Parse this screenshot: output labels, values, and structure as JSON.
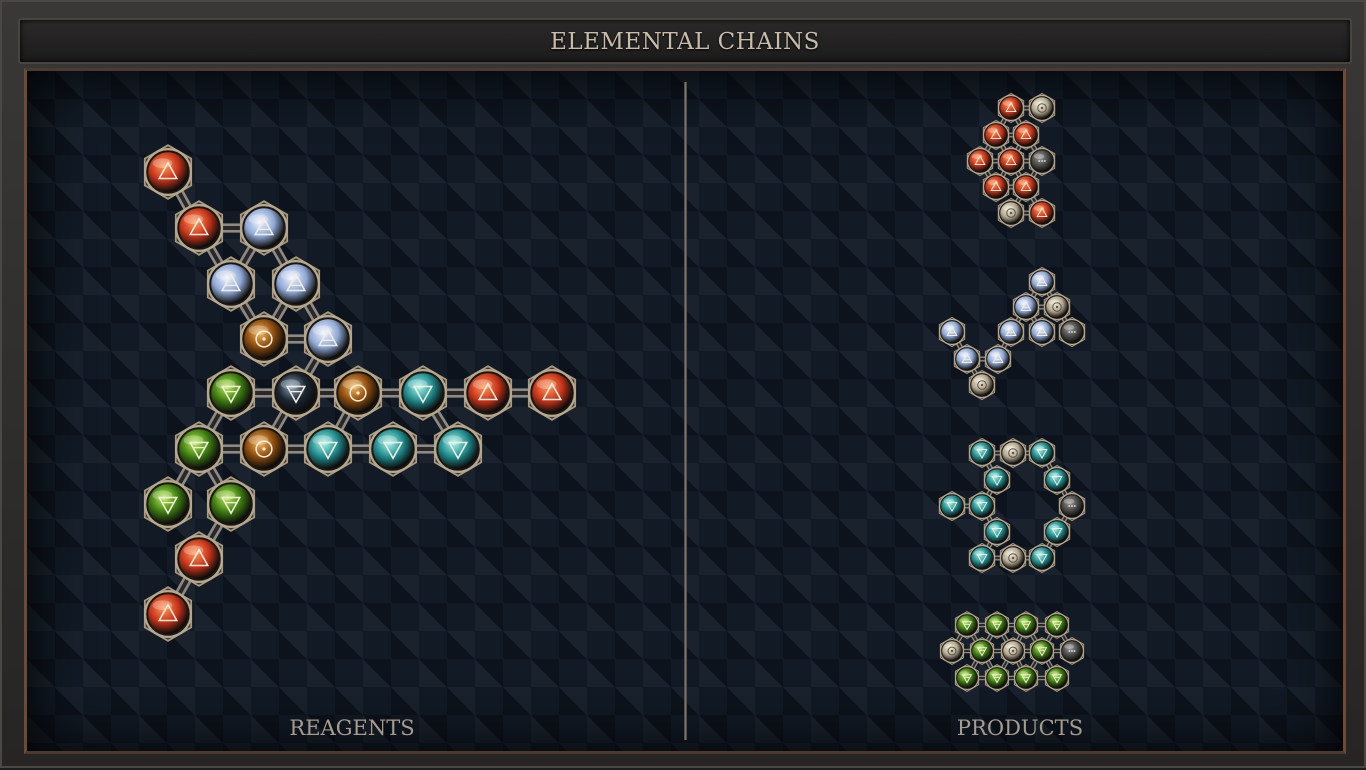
{
  "window": {
    "title": "ELEMENTAL CHAINS"
  },
  "panels": {
    "reagents_label": "REAGENTS",
    "products_label": "PRODUCTS"
  },
  "atom_types": {
    "fire": {
      "color": "#c8341a",
      "highlight": "#ff9a5a",
      "glyph": "triangle-up-icon"
    },
    "air": {
      "color": "#8fa9d6",
      "highlight": "#f2f6ff",
      "glyph": "triangle-up-bar-icon"
    },
    "water": {
      "color": "#1f8a8c",
      "highlight": "#a8f5ea",
      "glyph": "triangle-down-icon"
    },
    "earth": {
      "color": "#3d7a12",
      "highlight": "#b9ef55",
      "glyph": "triangle-down-bar-icon"
    },
    "salt": {
      "color": "#8a4a0c",
      "highlight": "#f5b55a",
      "glyph": "circle-dot-icon"
    },
    "quintessence": {
      "color": "#1b2530",
      "highlight": "#8aa4bd",
      "glyph": "triangle-down-bar-icon"
    },
    "vitae": {
      "color": "#b6ab93",
      "highlight": "#f1ead5",
      "glyph": "circle-dot-icon"
    },
    "mors": {
      "color": "#4a4a48",
      "highlight": "#9a9a96",
      "glyph": "dots-icon"
    }
  },
  "reagent": {
    "atoms": [
      "fire",
      "fire",
      "air",
      "air",
      "air",
      "salt",
      "air",
      "earth",
      "quintessence",
      "salt",
      "water",
      "fire",
      "fire",
      "earth",
      "salt",
      "water",
      "water",
      "water",
      "earth",
      "earth",
      "fire",
      "fire"
    ]
  },
  "products": [
    {
      "name": "product-1",
      "atoms": [
        "fire",
        "vitae",
        "fire",
        "fire",
        "fire",
        "fire",
        "mors",
        "fire",
        "fire",
        "vitae",
        "fire"
      ]
    },
    {
      "name": "product-2",
      "atoms": [
        "air",
        "air",
        "vitae",
        "air",
        "air",
        "mors",
        "air",
        "air",
        "vitae",
        "air"
      ]
    },
    {
      "name": "product-3",
      "atoms": [
        "water",
        "vitae",
        "water",
        "water",
        "water",
        "water",
        "water",
        "mors",
        "water",
        "water",
        "water",
        "vitae",
        "water"
      ]
    },
    {
      "name": "product-4",
      "atoms": [
        "earth",
        "earth",
        "earth",
        "earth",
        "vitae",
        "earth",
        "vitae",
        "earth",
        "mors",
        "earth",
        "earth",
        "earth",
        "earth"
      ]
    }
  ]
}
